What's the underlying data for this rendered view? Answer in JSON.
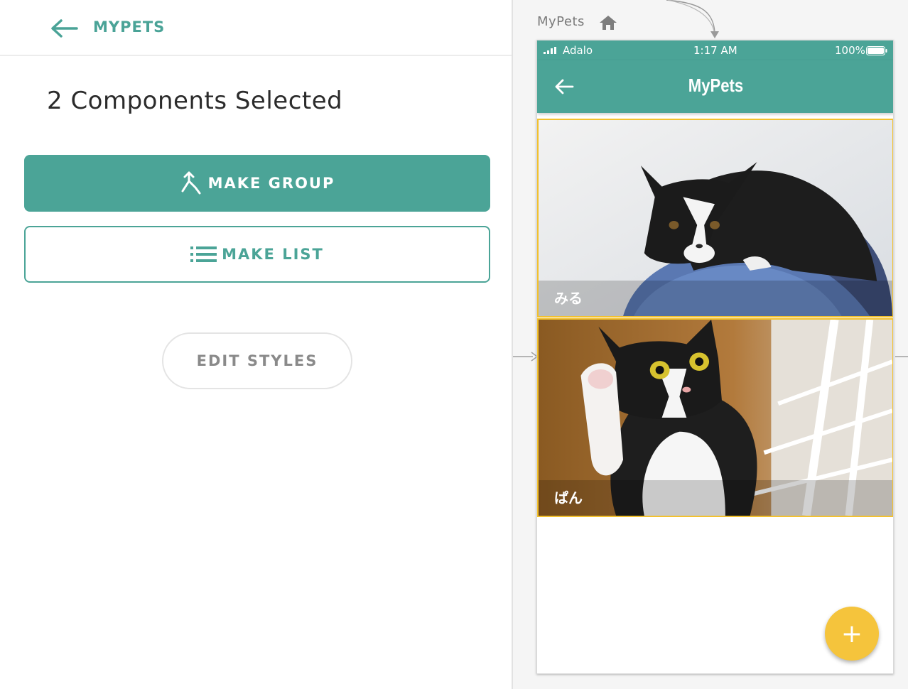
{
  "left_panel": {
    "header": {
      "title": "MYPETS",
      "back_icon": "arrow-left-icon"
    },
    "selection_title": "2 Components Selected",
    "buttons": {
      "make_group": {
        "label": "MAKE GROUP",
        "icon": "merge-icon"
      },
      "make_list": {
        "label": "MAKE LIST",
        "icon": "list-icon"
      },
      "edit_styles": {
        "label": "EDIT STYLES"
      }
    }
  },
  "canvas": {
    "screen_name": "MyPets",
    "home_icon": "home-icon"
  },
  "phone": {
    "status_bar": {
      "carrier": "Adalo",
      "time": "1:17 AM",
      "battery": "100%"
    },
    "app_bar": {
      "title": "MyPets",
      "back_icon": "arrow-left-icon"
    },
    "cards": [
      {
        "caption": "みる"
      },
      {
        "caption": "ぱん"
      }
    ],
    "fab": {
      "label": "+",
      "icon": "plus-icon"
    }
  },
  "colors": {
    "accent": "#4ba497",
    "selection": "#f2c12e",
    "fab": "#f5c43c"
  }
}
